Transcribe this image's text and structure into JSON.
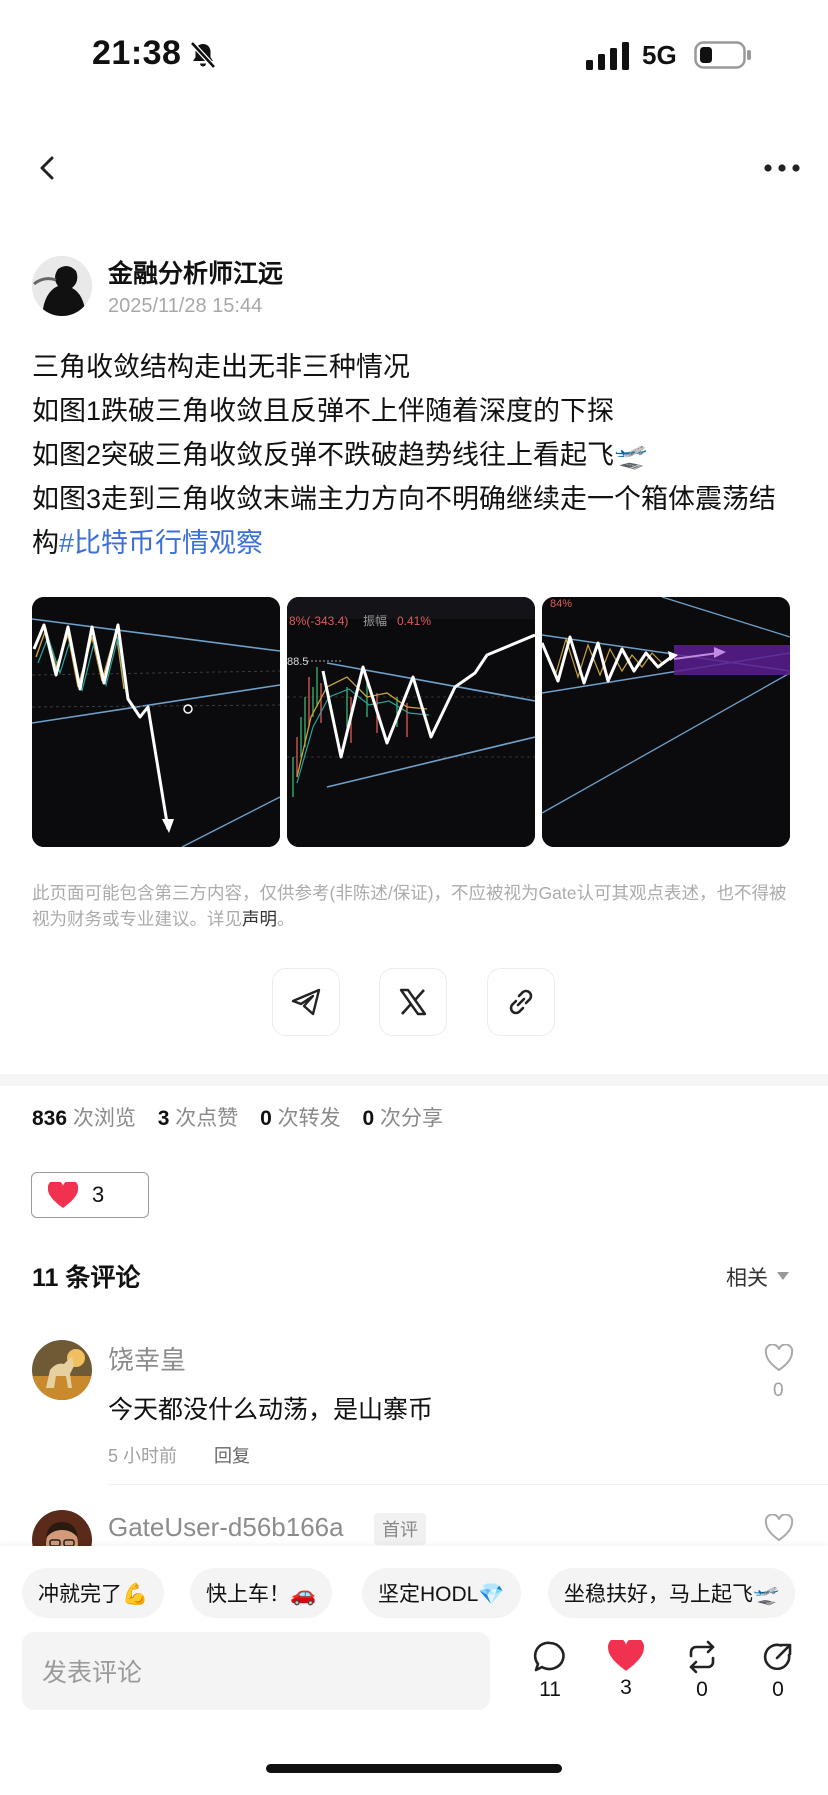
{
  "status_bar": {
    "time": "21:38",
    "network": "5G"
  },
  "author": {
    "name": "金融分析师江远",
    "date": "2025/11/28 15:44"
  },
  "post": {
    "lines": [
      "三角收敛结构走出无非三种情况",
      "如图1跌破三角收敛且反弹不上伴随着深度的下探",
      "如图2突破三角收敛反弹不跌破趋势线往上看起飞🛫",
      "如图3走到三角收敛末端主力方向不明确继续走一个箱体震荡结构"
    ],
    "hashtag": "#比特币行情观察"
  },
  "images": {
    "img2_label1": "8%(-343.4)",
    "img2_label2": "振幅",
    "img2_label3": "0.41%",
    "img2_price": "88.5",
    "img3_label": "84%"
  },
  "disclaimer": {
    "text": "此页面可能包含第三方内容，仅供参考(非陈述/保证)，不应被视为Gate认可其观点表述，也不得被视为财务或专业建议。详见",
    "link": "声明",
    "end": "。"
  },
  "stats": {
    "views": "836",
    "views_label": "次浏览",
    "likes": "3",
    "likes_label": "次点赞",
    "reposts": "0",
    "reposts_label": "次转发",
    "shares": "0",
    "shares_label": "次分享"
  },
  "like_button": {
    "count": "3"
  },
  "comments": {
    "title": "11 条评论",
    "sort": "相关",
    "items": [
      {
        "name": "饶幸皇",
        "text": "今天都没什么动荡，是山寨币",
        "time": "5 小时前",
        "reply": "回复",
        "likes": "0"
      },
      {
        "name": "GateUser-d56b166a",
        "badge": "首评"
      }
    ]
  },
  "quick_replies": [
    "冲就完了💪",
    "快上车！🚗",
    "坚定HODL💎",
    "坐稳扶好，马上起飞🛫"
  ],
  "composer": {
    "placeholder": "发表评论"
  },
  "actions": {
    "comments": "11",
    "likes": "3",
    "reposts": "0",
    "shares": "0"
  },
  "colors": {
    "accent_link": "#3b6fd9",
    "heart": "#f0314f"
  }
}
